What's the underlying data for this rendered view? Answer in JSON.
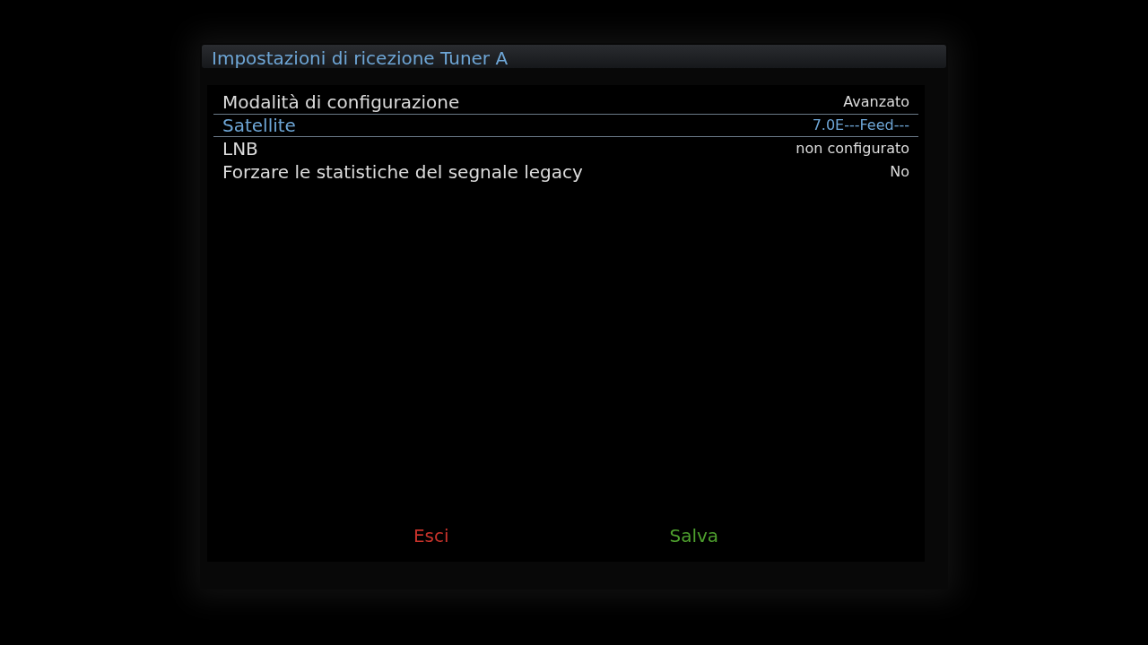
{
  "window": {
    "title": "Impostazioni di ricezione Tuner A"
  },
  "settings": [
    {
      "label": "Modalità di configurazione",
      "value": "Avanzato",
      "selected": false
    },
    {
      "label": "Satellite",
      "value": "7.0E---Feed---",
      "selected": true
    },
    {
      "label": "LNB",
      "value": "non configurato",
      "selected": false
    },
    {
      "label": "Forzare le statistiche del segnale legacy",
      "value": "No",
      "selected": false
    }
  ],
  "buttons": [
    {
      "label": "Esci",
      "color": "#c8332b"
    },
    {
      "label": "Salva",
      "color": "#4ea02e"
    }
  ]
}
